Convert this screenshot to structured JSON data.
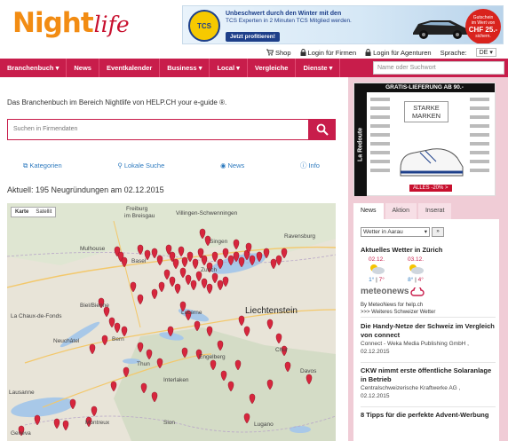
{
  "header": {
    "logo_part1": "Night",
    "logo_part2": "life",
    "banner": {
      "badge": "TCS",
      "headline": "Unbeschwert durch den Winter mit den",
      "sub": "TCS Experten in 2 Minuten TCS Mitglied werden.",
      "button": "Jetzt profitieren!",
      "stamp_line1": "Gutschein",
      "stamp_line2": "im Wert von",
      "stamp_value": "CHF 25.-",
      "stamp_line3": "sichern."
    },
    "links": {
      "shop": "Shop",
      "login_firms": "Login für Firmen",
      "login_agencies": "Login für Agenturen",
      "language_label": "Sprache:",
      "language_value": "DE"
    }
  },
  "nav": {
    "items": [
      "Branchenbuch",
      "News",
      "Eventkalender",
      "Business",
      "Local",
      "Vergleiche",
      "Dienste"
    ],
    "search_placeholder": "Name oder Suchwort"
  },
  "main": {
    "intro": "Das Branchenbuch im Bereich Nightlife von HELP.CH your e-guide ®.",
    "search_placeholder": "Suchen in Firmendaten",
    "tabs": [
      "Kategorien",
      "Lokale Suche",
      "News",
      "Info"
    ],
    "new_count": "Aktuell: 195 Neugründungen am 02.12.2015",
    "map": {
      "ctrl_map": "Karte",
      "ctrl_sat": "Satellit",
      "labels": [
        "Freiburg",
        "im Breisgau",
        "Villingen-Schwenningen",
        "Singen",
        "Ravensburg",
        "Mulhouse",
        "Basel",
        "Liechtenstein",
        "Biel/Bienne",
        "La Chaux-de-Fonds",
        "Lausanne",
        "Lucerne",
        "Bern",
        "Neuchâtel",
        "Zurich",
        "Chur",
        "Davos",
        "Geneva",
        "Sion",
        "Montreux",
        "Thun",
        "Interlaken",
        "Engelberg",
        "Lugano"
      ]
    }
  },
  "sidebar": {
    "ad": {
      "top": "GRATIS-LIEFERUNG AB 90.-",
      "side": "La Redoute",
      "marken": "STARKE MARKEN",
      "sales": "ALLES -20% >"
    },
    "widget": {
      "tabs": [
        "News",
        "Aktion",
        "Inserat"
      ],
      "weather_select": "Wetter in Aarau",
      "weather_go": "»",
      "weather_head": "Aktuelles Wetter in Zürich",
      "days": [
        {
          "date": "02.12.",
          "lo": "1°",
          "hi": "7°"
        },
        {
          "date": "03.12.",
          "lo": "8°",
          "hi": "4°"
        }
      ],
      "meteo_brand": "meteonews",
      "meteo_by": "By MeteoNews for help.ch",
      "meteo_more": ">>> Weiteres Schweizer Wetter",
      "news": [
        {
          "title": "Die Handy-Netze der Schweiz im Vergleich von connect",
          "source": "Connect - Weka Media Publishing GmbH ,",
          "date": "02.12.2015"
        },
        {
          "title": "CKW nimmt erste öffentliche Solaranlage in Betrieb",
          "source": "Centralschweizerische Kraftwerke AG ,",
          "date": "02.12.2015"
        },
        {
          "title": "8 Tipps für die perfekte Advent-Werbung",
          "source": "",
          "date": ""
        }
      ]
    }
  },
  "colors": {
    "brand": "#c81d4b",
    "logo_orange": "#f28c13",
    "link_blue": "#2f7bbf",
    "sidebar_bg": "#f0ccd6"
  }
}
